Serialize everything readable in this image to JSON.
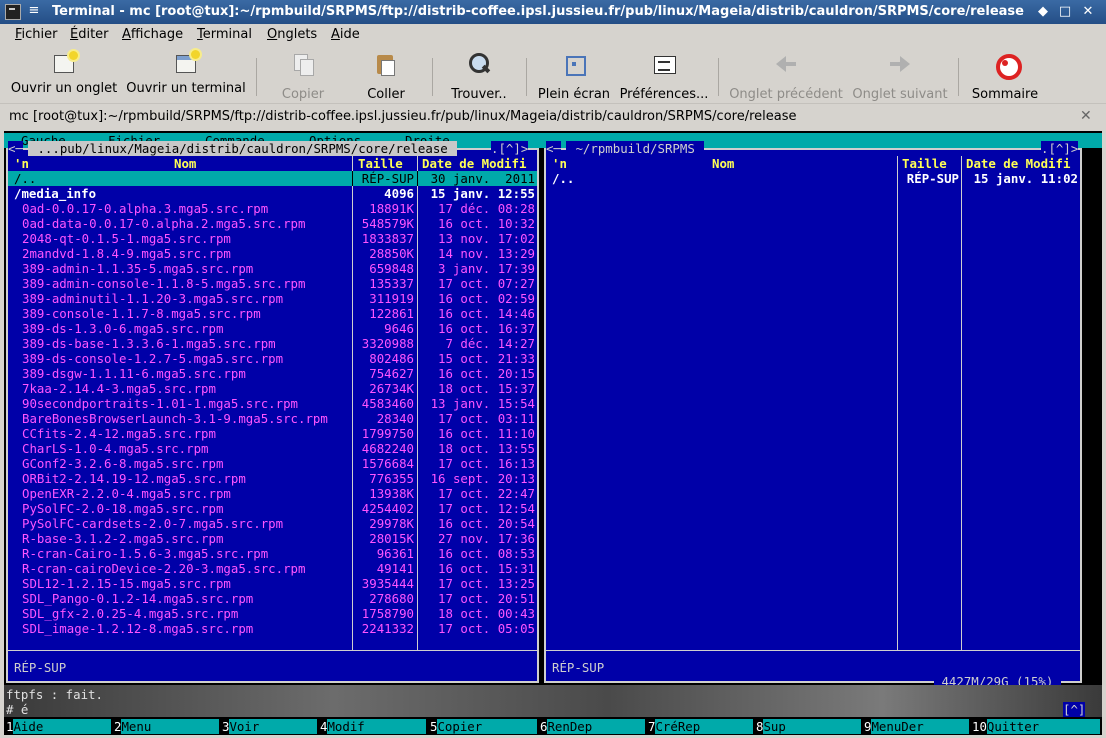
{
  "window": {
    "title": "Terminal - mc [root@tux]:~/rpmbuild/SRPMS/ftp://distrib-coffee.ipsl.jussieu.fr/pub/linux/Mageia/distrib/cauldron/SRPMS/core/release",
    "menu_glyph": "≡",
    "minimize_glyph": "◆",
    "maximize_glyph": "□",
    "close_glyph": "✕"
  },
  "menubar": {
    "items": [
      {
        "u": "F",
        "rest": "ichier"
      },
      {
        "u": "É",
        "rest": "diter"
      },
      {
        "u": "A",
        "rest": "ffichage"
      },
      {
        "u": "T",
        "rest": "erminal"
      },
      {
        "u": "O",
        "rest": "nglets"
      },
      {
        "u": "A",
        "rest": "ide"
      }
    ]
  },
  "toolbar": {
    "new_tab": "Ouvrir un onglet",
    "new_window": "Ouvrir un terminal",
    "copy": "Copier",
    "paste": "Coller",
    "find": "Trouver..",
    "fullscreen": "Plein écran",
    "preferences": "Préférences...",
    "prev_tab": "Onglet précédent",
    "next_tab": "Onglet suivant",
    "help": "Sommaire"
  },
  "tab": {
    "title": "mc [root@tux]:~/rpmbuild/SRPMS/ftp://distrib-coffee.ipsl.jussieu.fr/pub/linux/Mageia/distrib/cauldron/SRPMS/core/release",
    "close_glyph": "✕"
  },
  "mc": {
    "menu": [
      "Gauche",
      "Fichier",
      "Commande",
      "Options",
      "Droite"
    ],
    "left": {
      "corner_left": "<─",
      "path": " ...pub/linux/Mageia/distrib/cauldron/SRPMS/core/release ",
      "corner_right": ".[^]>",
      "col_sort": "'n",
      "col_name": "Nom",
      "col_size": "Taille",
      "col_date": "Date de Modifi",
      "status": "RÉP-SUP",
      "rows": [
        {
          "name": "/..",
          "size": "RÉP-SUP",
          "date": "30 janv.  2011",
          "kind": "sel"
        },
        {
          "name": "/media_info",
          "size": "4096",
          "date": "15 janv. 12:55",
          "kind": "dir"
        },
        {
          "name": "0ad-0.0.17-0.alpha.3.mga5.src.rpm",
          "size": "18891K",
          "date": "17 déc. 08:28",
          "kind": "file"
        },
        {
          "name": "0ad-data-0.0.17-0.alpha.2.mga5.src.rpm",
          "size": "548579K",
          "date": "16 oct. 10:32",
          "kind": "file"
        },
        {
          "name": "2048-qt-0.1.5-1.mga5.src.rpm",
          "size": "1833837",
          "date": "13 nov. 17:02",
          "kind": "file"
        },
        {
          "name": "2mandvd-1.8.4-9.mga5.src.rpm",
          "size": "28850K",
          "date": "14 nov. 13:29",
          "kind": "file"
        },
        {
          "name": "389-admin-1.1.35-5.mga5.src.rpm",
          "size": "659848",
          "date": "3 janv. 17:39",
          "kind": "file"
        },
        {
          "name": "389-admin-console-1.1.8-5.mga5.src.rpm",
          "size": "135337",
          "date": "17 oct. 07:27",
          "kind": "file"
        },
        {
          "name": "389-adminutil-1.1.20-3.mga5.src.rpm",
          "size": "311919",
          "date": "16 oct. 02:59",
          "kind": "file"
        },
        {
          "name": "389-console-1.1.7-8.mga5.src.rpm",
          "size": "122861",
          "date": "16 oct. 14:46",
          "kind": "file"
        },
        {
          "name": "389-ds-1.3.0-6.mga5.src.rpm",
          "size": "9646",
          "date": "16 oct. 16:37",
          "kind": "file"
        },
        {
          "name": "389-ds-base-1.3.3.6-1.mga5.src.rpm",
          "size": "3320988",
          "date": "7 déc. 14:27",
          "kind": "file"
        },
        {
          "name": "389-ds-console-1.2.7-5.mga5.src.rpm",
          "size": "802486",
          "date": "15 oct. 21:33",
          "kind": "file"
        },
        {
          "name": "389-dsgw-1.1.11-6.mga5.src.rpm",
          "size": "754627",
          "date": "16 oct. 20:15",
          "kind": "file"
        },
        {
          "name": "7kaa-2.14.4-3.mga5.src.rpm",
          "size": "26734K",
          "date": "18 oct. 15:37",
          "kind": "file"
        },
        {
          "name": "90secondportraits-1.01-1.mga5.src.rpm",
          "size": "4583460",
          "date": "13 janv. 15:54",
          "kind": "file"
        },
        {
          "name": "BareBonesBrowserLaunch-3.1-9.mga5.src.rpm",
          "size": "28340",
          "date": "17 oct. 03:11",
          "kind": "file"
        },
        {
          "name": "CCfits-2.4-12.mga5.src.rpm",
          "size": "1799750",
          "date": "16 oct. 11:10",
          "kind": "file"
        },
        {
          "name": "CharLS-1.0-4.mga5.src.rpm",
          "size": "4682240",
          "date": "18 oct. 13:55",
          "kind": "file"
        },
        {
          "name": "GConf2-3.2.6-8.mga5.src.rpm",
          "size": "1576684",
          "date": "17 oct. 16:13",
          "kind": "file"
        },
        {
          "name": "ORBit2-2.14.19-12.mga5.src.rpm",
          "size": "776355",
          "date": "16 sept. 20:13",
          "kind": "file"
        },
        {
          "name": "OpenEXR-2.2.0-4.mga5.src.rpm",
          "size": "13938K",
          "date": "17 oct. 22:47",
          "kind": "file"
        },
        {
          "name": "PySolFC-2.0-18.mga5.src.rpm",
          "size": "4254402",
          "date": "17 oct. 12:54",
          "kind": "file"
        },
        {
          "name": "PySolFC-cardsets-2.0-7.mga5.src.rpm",
          "size": "29978K",
          "date": "16 oct. 20:54",
          "kind": "file"
        },
        {
          "name": "R-base-3.1.2-2.mga5.src.rpm",
          "size": "28015K",
          "date": "27 nov. 17:36",
          "kind": "file"
        },
        {
          "name": "R-cran-Cairo-1.5.6-3.mga5.src.rpm",
          "size": "96361",
          "date": "16 oct. 08:53",
          "kind": "file"
        },
        {
          "name": "R-cran-cairoDevice-2.20-3.mga5.src.rpm",
          "size": "49141",
          "date": "16 oct. 15:31",
          "kind": "file"
        },
        {
          "name": "SDL12-1.2.15-15.mga5.src.rpm",
          "size": "3935444",
          "date": "17 oct. 13:25",
          "kind": "file"
        },
        {
          "name": "SDL_Pango-0.1.2-14.mga5.src.rpm",
          "size": "278680",
          "date": "17 oct. 20:51",
          "kind": "file"
        },
        {
          "name": "SDL_gfx-2.0.25-4.mga5.src.rpm",
          "size": "1758790",
          "date": "18 oct. 00:43",
          "kind": "file"
        },
        {
          "name": "SDL_image-1.2.12-8.mga5.src.rpm",
          "size": "2241332",
          "date": "17 oct. 05:05",
          "kind": "file"
        }
      ]
    },
    "right": {
      "corner_left": "<─",
      "path": " ~/rpmbuild/SRPMS ",
      "corner_right": ".[^]>",
      "col_sort": "'n",
      "col_name": "Nom",
      "col_size": "Taille",
      "col_date": "Date de Modifi",
      "status": "RÉP-SUP",
      "disk": " 4427M/29G (15%) ",
      "rows": [
        {
          "name": "/..",
          "size": "RÉP-SUP",
          "date": "15 janv. 11:02",
          "kind": "dirw"
        }
      ]
    },
    "cmd_output": "ftpfs : fait.",
    "prompt": "# é",
    "hint_marker": "[^]",
    "fkeys": [
      {
        "n": "1",
        "label": "Aide"
      },
      {
        "n": "2",
        "label": "Menu"
      },
      {
        "n": "3",
        "label": "Voir"
      },
      {
        "n": "4",
        "label": "Modif"
      },
      {
        "n": "5",
        "label": "Copier"
      },
      {
        "n": "6",
        "label": "RenDep"
      },
      {
        "n": "7",
        "label": "CréRep"
      },
      {
        "n": "8",
        "label": "Sup"
      },
      {
        "n": "9",
        "label": "MenuDer"
      },
      {
        "n": "10",
        "label": "Quitter"
      }
    ]
  },
  "colors": {
    "panel_bg": "#0000a8",
    "selection": "#00aaaa",
    "file_text": "#ff55ff",
    "header_text": "#ffff55",
    "titlebar": "#2d5a93"
  }
}
